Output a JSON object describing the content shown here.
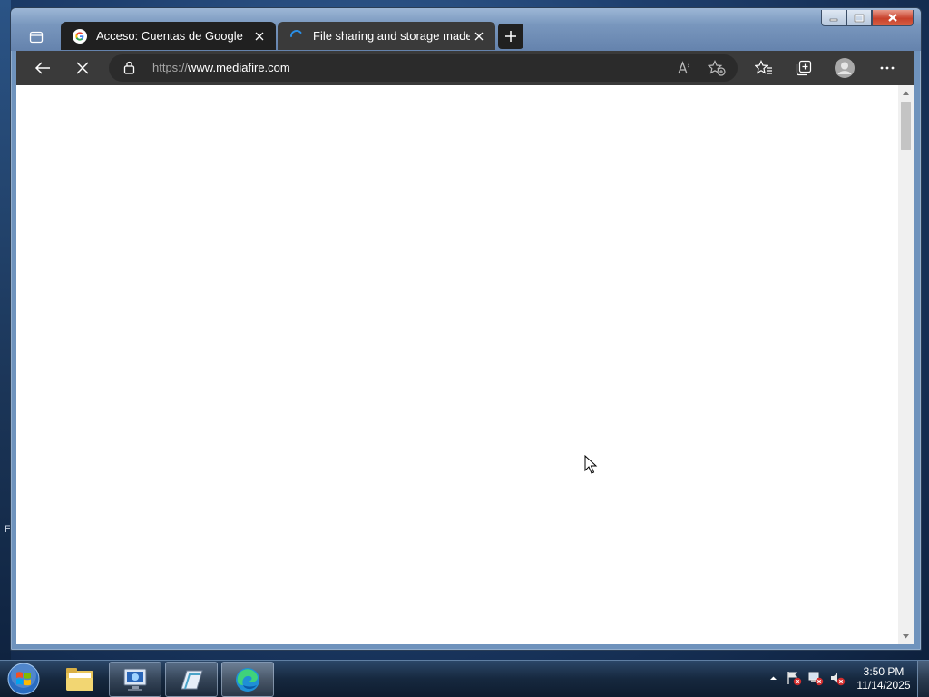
{
  "desktop": {
    "stray_char": "F"
  },
  "browser": {
    "tabs": [
      {
        "title": "Acceso: Cuentas de Google",
        "active": true,
        "favicon": "google-g-icon"
      },
      {
        "title": "File sharing and storage made simple",
        "active": false,
        "favicon": "loading-spinner-icon"
      }
    ],
    "address": {
      "protocol": "https://",
      "host": "www.mediafire.com"
    },
    "icons": {
      "back": "back-arrow-icon",
      "stop": "stop-loading-icon",
      "read_aloud": "read-aloud-icon",
      "favorite": "add-favorite-icon",
      "favorites": "favorites-icon",
      "collections": "collections-icon",
      "profile": "profile-avatar-icon",
      "more": "more-menu-icon"
    },
    "colors": {
      "tab_active": "#202020",
      "toolbar": "#3a3a3a",
      "accent": "#2b8fe6"
    }
  },
  "taskbar": {
    "apps": [
      "windows-explorer",
      "remote-desktop",
      "notepad-like",
      "microsoft-edge"
    ],
    "clock": {
      "time": "3:50 PM",
      "date": "11/14/2025"
    }
  }
}
